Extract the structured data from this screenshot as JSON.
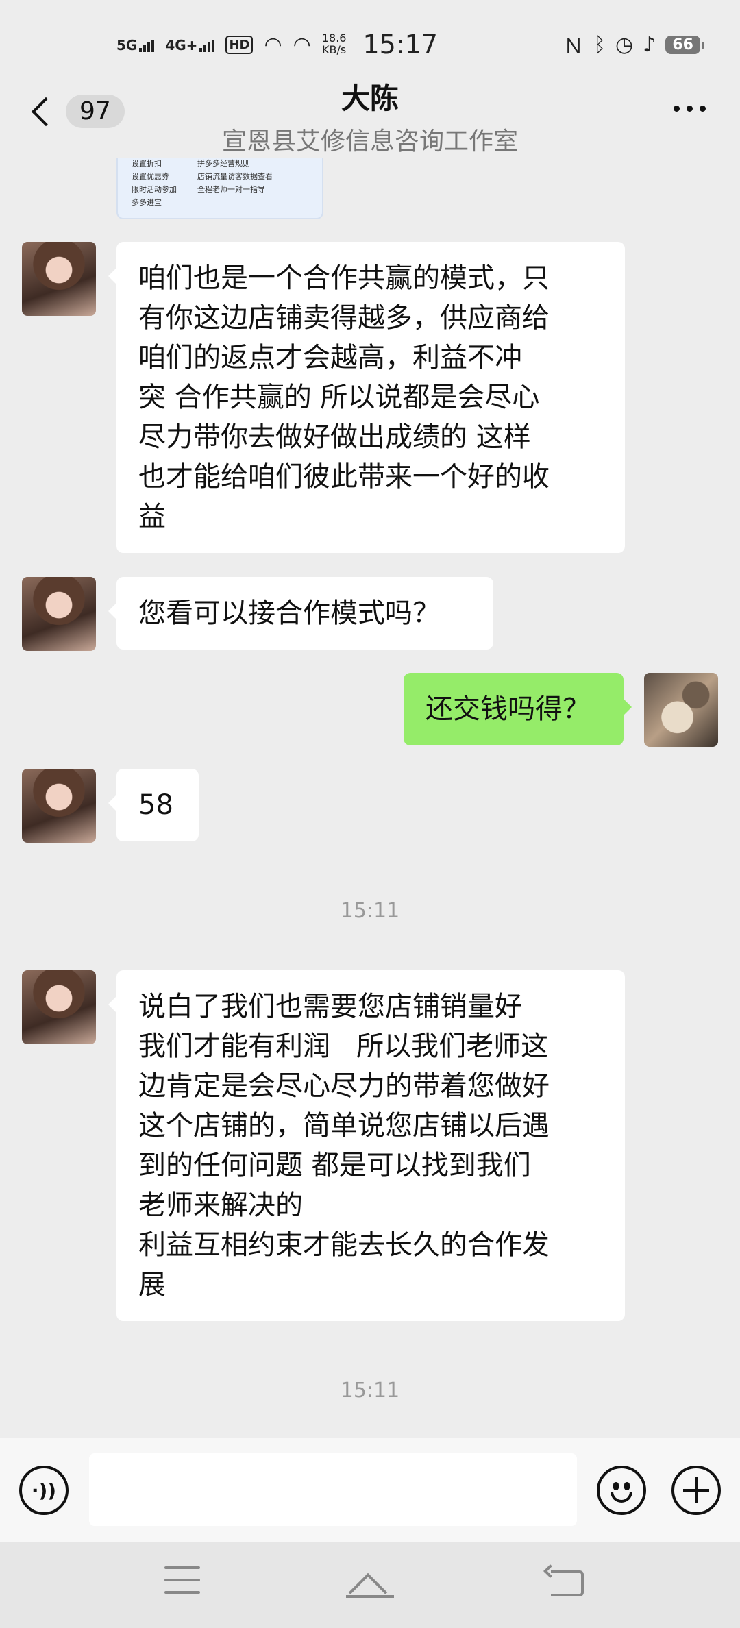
{
  "status_bar": {
    "net1": "5G",
    "net2": "4G+",
    "hd": "HD",
    "speed_value": "18.6",
    "speed_unit": "KB/s",
    "time": "15:17",
    "battery": "66"
  },
  "header": {
    "back_badge": "97",
    "title": "大陈",
    "subtitle": "宣恩县艾修信息咨询工作室"
  },
  "image_card": {
    "col1": [
      "设置折扣",
      "设置优惠券",
      "限时活动参加",
      "多多进宝"
    ],
    "col2": [
      "拼多多经营规则",
      "店铺流量访客数据查看",
      "全程老师一对一指导"
    ]
  },
  "messages": [
    {
      "sender": "other",
      "text": "咱们也是一个合作共赢的模式，只\n有你这边店铺卖得越多，供应商给\n咱们的返点才会越高，利益不冲\n突 合作共赢的 所以说都是会尽心\n尽力带你去做好做出成绩的 这样\n也才能给咱们彼此带来一个好的收\n益"
    },
    {
      "sender": "other",
      "text": "您看可以接合作模式吗？"
    },
    {
      "sender": "me",
      "text": "还交钱吗得？"
    },
    {
      "sender": "other",
      "text": "58"
    },
    {
      "sender": "other",
      "text": "说白了我们也需要您店铺销量好\n我们才能有利润   所以我们老师这\n边肯定是会尽心尽力的带着您做好\n这个店铺的，简单说您店铺以后遇\n到的任何问题 都是可以找到我们\n老师来解决的\n利益互相约束才能去长久的合作发\n展"
    }
  ],
  "timestamps": [
    "15:11",
    "15:11"
  ],
  "input": {
    "value": "",
    "placeholder": ""
  },
  "icons": {
    "voice": "voice-icon",
    "emoji": "emoji-icon",
    "plus": "plus-icon"
  },
  "colors": {
    "my_bubble": "#95ec69",
    "other_bubble": "#ffffff",
    "background": "#ededed"
  }
}
